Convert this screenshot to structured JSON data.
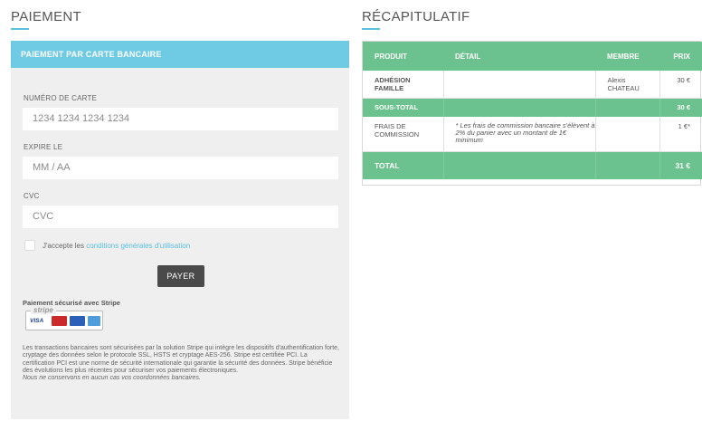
{
  "payment": {
    "title": "PAIEMENT",
    "header": "PAIEMENT PAR CARTE BANCAIRE",
    "card_number_label": "NUMÉRO DE CARTE",
    "card_number_placeholder": "1234 1234 1234 1234",
    "expiry_label": "EXPIRE LE",
    "expiry_placeholder": "MM / AA",
    "cvc_label": "CVC",
    "cvc_placeholder": "CVC",
    "accept_prefix": "J'accepte les ",
    "accept_link": "conditions générales d'utilisation",
    "pay_button": "PAYER",
    "secure_label": "Paiement sécurisé avec Stripe",
    "stripe_word": "stripe",
    "visa_text": "VISA",
    "legal_text": "Les transactions bancaires sont sécurisées par la solution Stripe qui intègre les dispositifs d'authentification forte, cryptage des données selon le protocole SSL, HSTS et cryptage AES-256. Stripe est certifiée PCI. La certification PCI est une norme de sécurité internationale qui garantie la sécurité des données. Stripe bénéficie des évolutions les plus récentes pour sécuriser vos paiements électroniques.",
    "legal_note": "Nous ne conservons en aucun cas vos coordonnées bancaires."
  },
  "summary": {
    "title": "RÉCAPITULATIF",
    "columns": [
      "PRODUIT",
      "DÉTAIL",
      "MEMBRE",
      "PRIX"
    ],
    "item": {
      "product_line1": "ADHÉSION",
      "product_line2": "FAMILLE",
      "detail": "",
      "member_line1": "Alexis",
      "member_line2": "CHATEAU",
      "price": "30 €"
    },
    "subtotal": {
      "label": "SOUS-TOTAL",
      "price": "30 €"
    },
    "fee": {
      "product_line1": "FRAIS DE",
      "product_line2": "COMMISSION",
      "detail": "* Les frais de commission bancaire s'élèvent à 2% du panier avec un montant de 1€ minimum",
      "member": "",
      "price": "1 €*"
    },
    "total": {
      "label": "TOTAL",
      "price": "31 €"
    }
  },
  "colors": {
    "blue_accent": "#6fcbe3",
    "green_accent": "#6cc28e",
    "link": "#5bc0de"
  }
}
